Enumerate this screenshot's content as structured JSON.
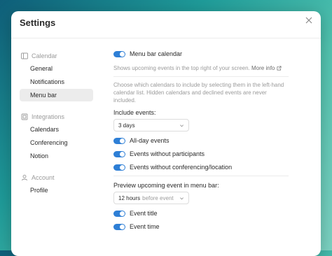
{
  "window": {
    "title": "Settings"
  },
  "sidebar": {
    "sections": [
      {
        "label": "Calendar",
        "items": [
          "General",
          "Notifications",
          "Menu bar"
        ]
      },
      {
        "label": "Integrations",
        "items": [
          "Calendars",
          "Conferencing",
          "Notion"
        ]
      },
      {
        "label": "Account",
        "items": [
          "Profile"
        ]
      }
    ],
    "active_item": "Menu bar"
  },
  "content": {
    "menu_bar_calendar": {
      "label": "Menu bar calendar",
      "enabled": true
    },
    "description": "Shows upcoming events in the top right of your screen.",
    "more_info": "More info",
    "calendars_hint": "Choose which calendars to include by selecting them in the left-hand calendar list. Hidden calendars and declined events are never included.",
    "include_events": {
      "label": "Include events:",
      "value": "3 days"
    },
    "toggles": [
      {
        "label": "All-day events",
        "enabled": true
      },
      {
        "label": "Events without participants",
        "enabled": true
      },
      {
        "label": "Events without conferencing/location",
        "enabled": true
      }
    ],
    "preview": {
      "label": "Preview upcoming event in menu bar:",
      "value": "12 hours",
      "suffix": "before event"
    },
    "preview_toggles": [
      {
        "label": "Event title",
        "enabled": true
      },
      {
        "label": "Event time",
        "enabled": true
      }
    ]
  },
  "colors": {
    "accent": "#2e7fd6",
    "active_bg": "#ececec"
  }
}
